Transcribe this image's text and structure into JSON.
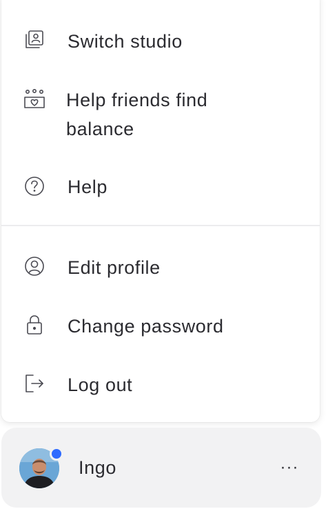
{
  "menu": {
    "items": [
      {
        "label": "Switch studio",
        "icon": "switch-studio-icon"
      },
      {
        "label": "Help friends find balance",
        "icon": "friends-heart-icon"
      },
      {
        "label": "Help",
        "icon": "question-circle-icon"
      },
      {
        "label": "Edit profile",
        "icon": "user-circle-icon"
      },
      {
        "label": "Change password",
        "icon": "lock-icon"
      },
      {
        "label": "Log out",
        "icon": "logout-icon"
      }
    ]
  },
  "user": {
    "name": "Ingo",
    "more_label": "···",
    "presence_color": "#2f6bff"
  }
}
